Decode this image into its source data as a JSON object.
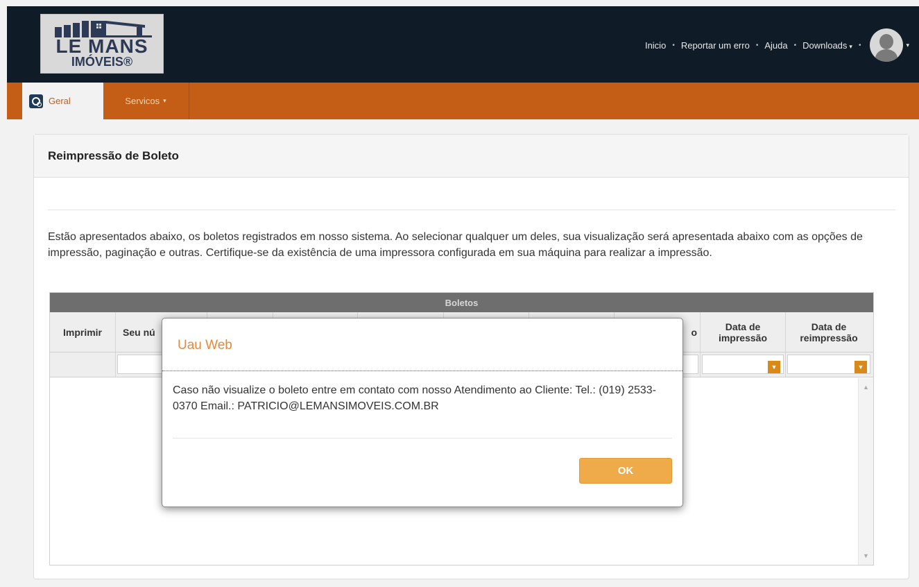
{
  "header": {
    "logo": {
      "line1": "LE MANS",
      "line2": "IMÓVEIS®"
    },
    "nav": [
      {
        "label": "Inicio"
      },
      {
        "label": "Reportar um erro"
      },
      {
        "label": "Ajuda"
      },
      {
        "label": "Downloads"
      }
    ],
    "separator": "•",
    "caret": "▾"
  },
  "subnav": {
    "tabs": [
      {
        "label": "Geral",
        "icon": "settings-gears-icon",
        "active": true
      },
      {
        "label": "Servicos",
        "has_dropdown": true
      }
    ]
  },
  "panel": {
    "title": "Reimpressão de Boleto",
    "description": "Estão apresentados abaixo, os boletos registrados em nosso sistema. Ao selecionar qualquer um deles, sua visualização será apresentada abaixo com as opções de impressão, paginação e outras. Certifique-se da existência de uma impressora configurada em sua máquina para realizar a impressão."
  },
  "grid": {
    "title": "Boletos",
    "columns": [
      {
        "label": "Imprimir"
      },
      {
        "label": "Seu nú"
      },
      {
        "label": ""
      },
      {
        "label": ""
      },
      {
        "label": ""
      },
      {
        "label": ""
      },
      {
        "label": ""
      },
      {
        "label": "o"
      },
      {
        "label": "Data de impressão"
      },
      {
        "label": "Data de reimpressão"
      }
    ],
    "rows": []
  },
  "modal": {
    "title": "Uau Web",
    "message": "Caso não visualize o boleto entre em contato com nosso Atendimento ao Cliente: Tel.: (019) 2533-0370 Email.: PATRICIO@LEMANSIMOVEIS.COM.BR",
    "ok_label": "OK"
  },
  "colors": {
    "header_bg": "#0f1b26",
    "subnav_bg": "#c45e17",
    "accent_orange": "#efab4a",
    "modal_title": "#e8883a"
  }
}
